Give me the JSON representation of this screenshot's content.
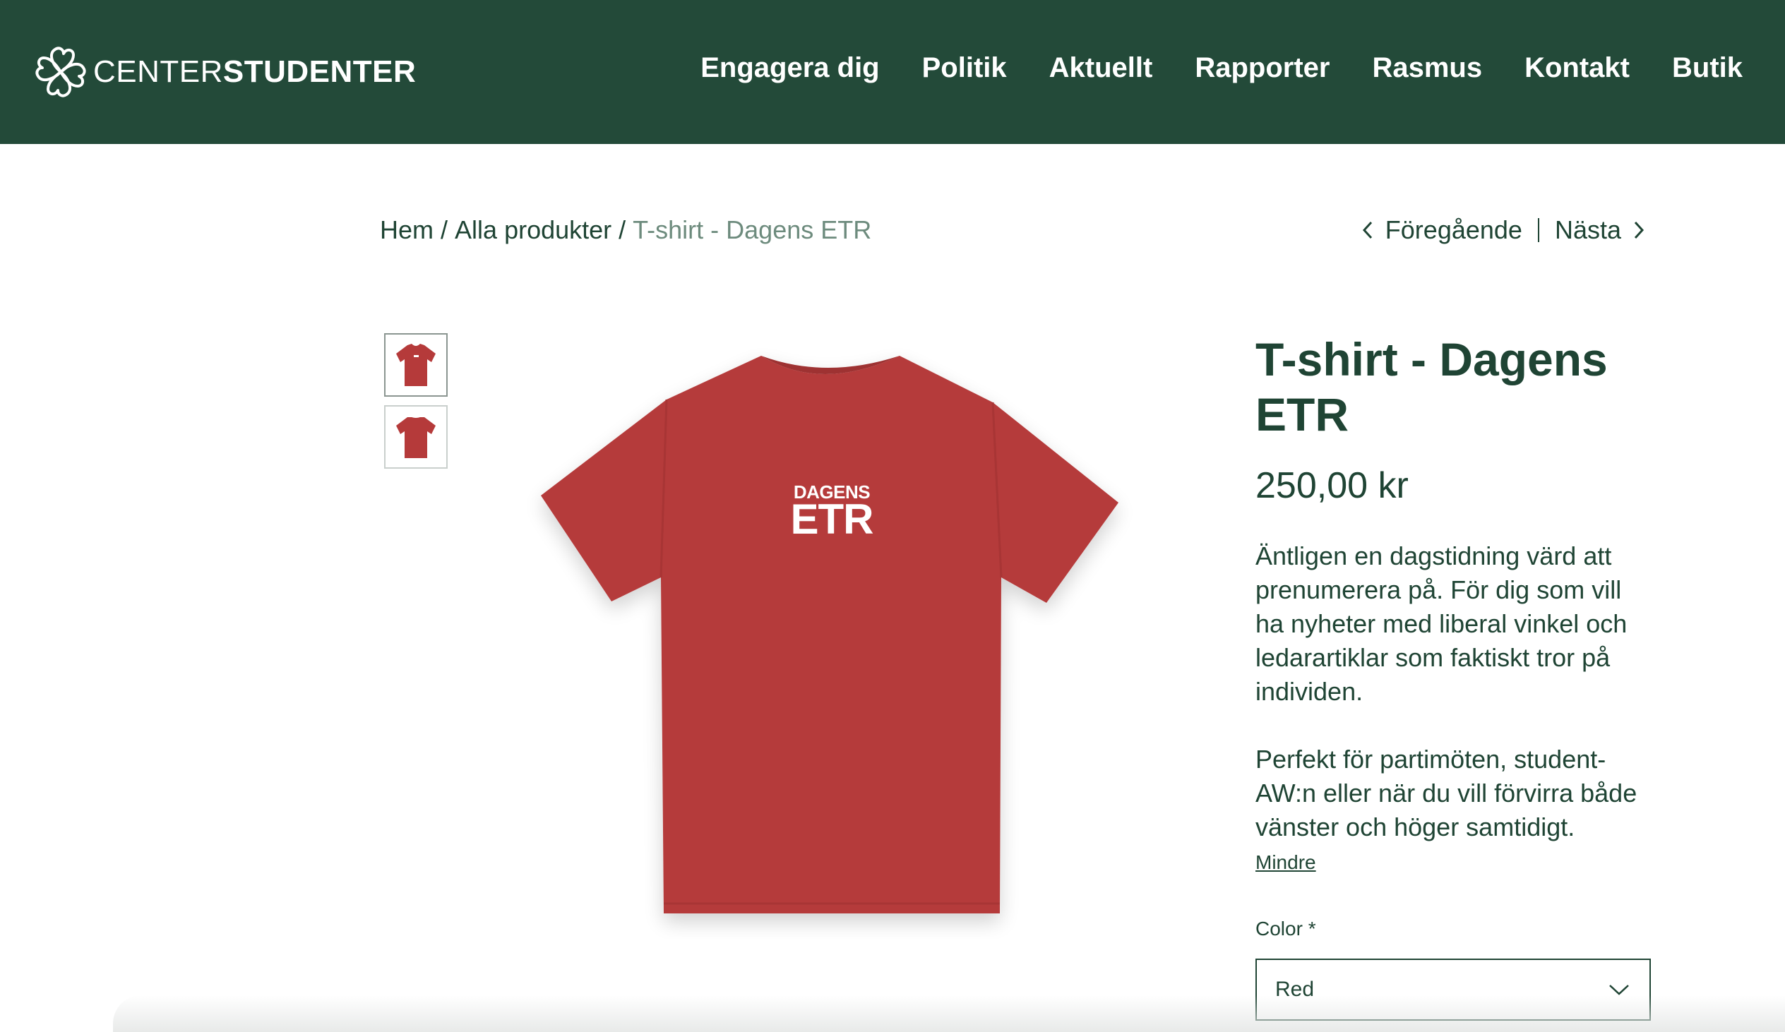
{
  "header": {
    "logo_light": "CENTER",
    "logo_bold": "STUDENTER",
    "nav": [
      "Engagera dig",
      "Politik",
      "Aktuellt",
      "Rapporter",
      "Rasmus",
      "Kontakt",
      "Butik"
    ]
  },
  "breadcrumb": {
    "home": "Hem",
    "separator": "/",
    "category": "Alla produkter",
    "current": "T-shirt - Dagens ETR"
  },
  "pager": {
    "prev": "Föregående",
    "next": "Nästa"
  },
  "product": {
    "title": "T-shirt - Dagens ETR",
    "price": "250,00 kr",
    "description_1": "Äntligen en dagstidning värd att prenumerera på. För dig som vill ha nyheter med liberal vinkel och ledarartiklar som faktiskt tror på individen.",
    "description_2": "Perfekt för partimöten, student-AW:n eller när du vill förvirra både vänster och höger samtidigt.",
    "less_link": "Mindre",
    "color_label": "Color *",
    "color_value": "Red",
    "shirt_print_top": "DAGENS",
    "shirt_print_bottom": "ETR",
    "shirt_color": "#b53a3a"
  },
  "colors": {
    "header_bg": "#234a39",
    "text": "#1f4434",
    "muted": "#6d8b7d"
  }
}
